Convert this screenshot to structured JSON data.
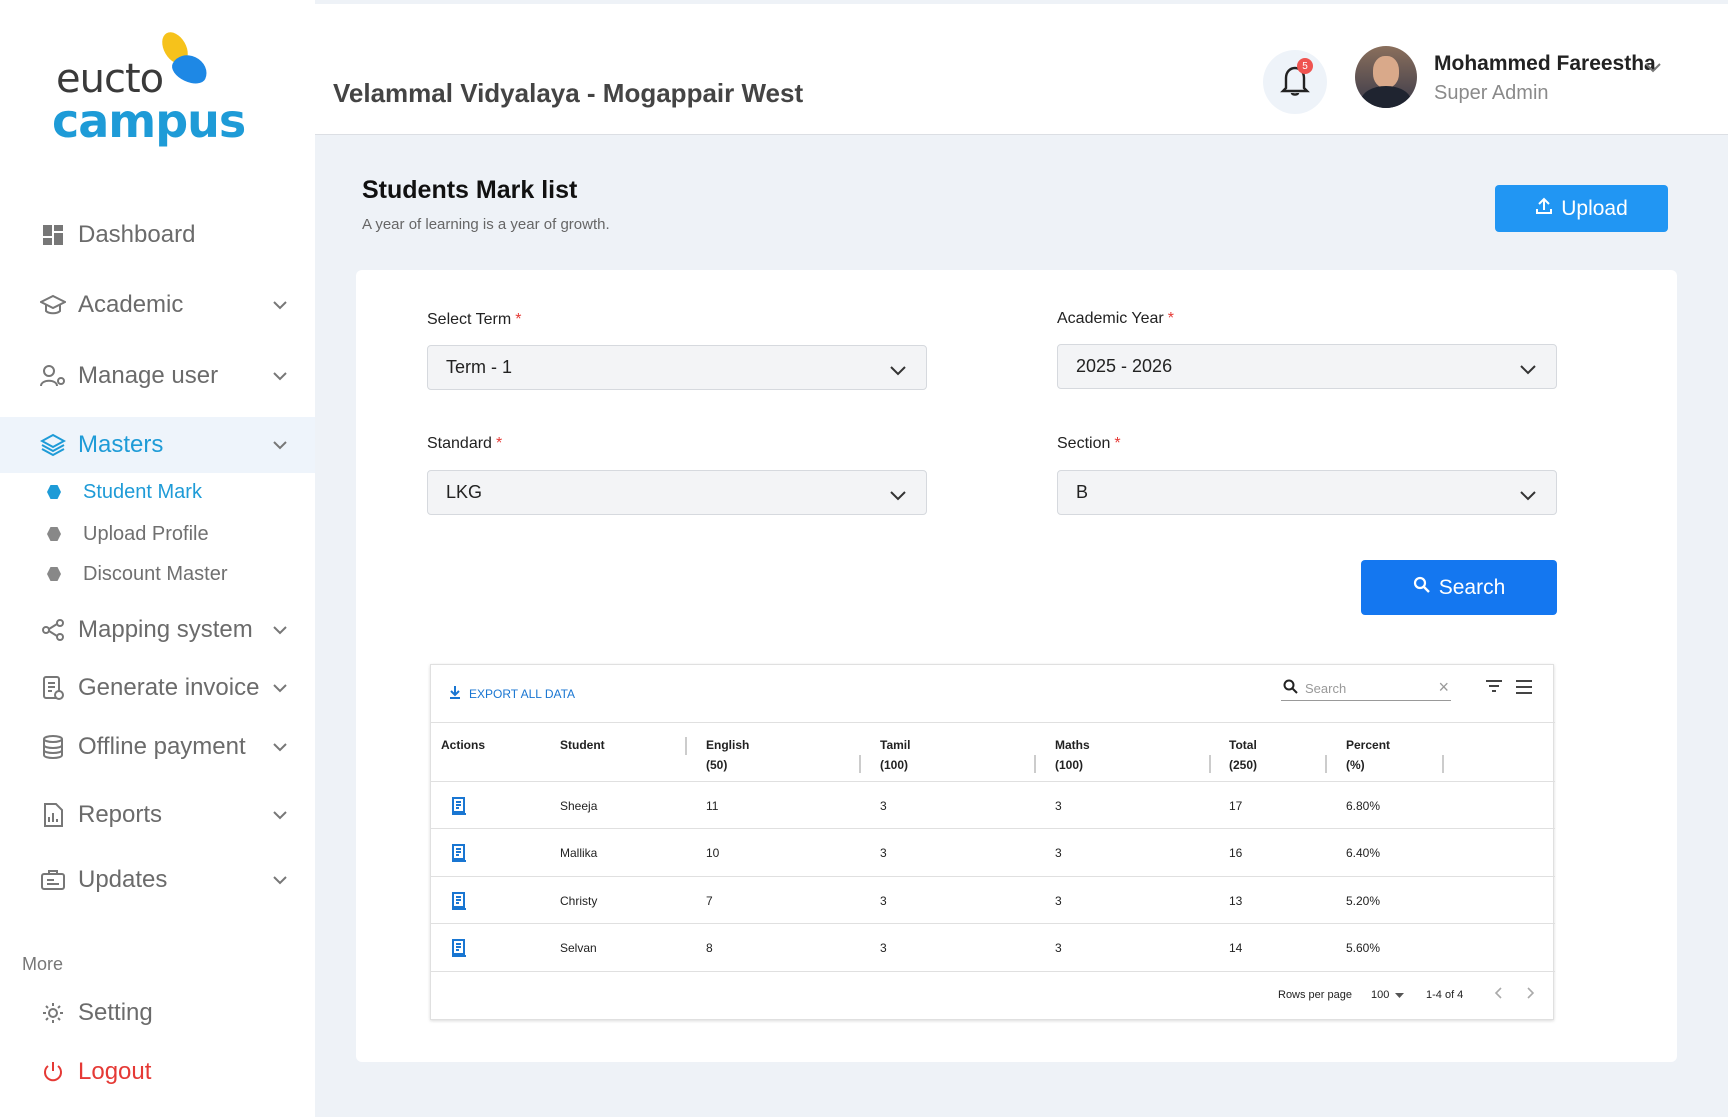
{
  "brand": {
    "line1": "eucto",
    "line2": "campus"
  },
  "sidebar": {
    "items": [
      {
        "label": "Dashboard",
        "icon": "dashboard-icon"
      },
      {
        "label": "Academic",
        "icon": "graduation-cap-icon"
      },
      {
        "label": "Manage user",
        "icon": "user-gear-icon"
      },
      {
        "label": "Masters",
        "icon": "layers-icon"
      },
      {
        "label": "Mapping system",
        "icon": "share-nodes-icon"
      },
      {
        "label": "Generate invoice",
        "icon": "invoice-icon"
      },
      {
        "label": "Offline payment",
        "icon": "database-icon"
      },
      {
        "label": "Reports",
        "icon": "report-icon"
      },
      {
        "label": "Updates",
        "icon": "updates-icon"
      }
    ],
    "sub_items": [
      "Student Mark",
      "Upload Profile",
      "Discount Master"
    ],
    "more_label": "More",
    "setting": "Setting",
    "logout": "Logout"
  },
  "header": {
    "school": "Velammal Vidyalaya - Mogappair West",
    "notification_count": "5",
    "user_name": "Mohammed Fareestha",
    "user_role": "Super Admin"
  },
  "page": {
    "title": "Students Mark list",
    "subtitle": "A year of learning is a year of growth.",
    "upload_label": "Upload"
  },
  "form": {
    "term_label": "Select Term",
    "term_value": "Term - 1",
    "year_label": "Academic Year",
    "year_value": "2025 - 2026",
    "standard_label": "Standard",
    "standard_value": "LKG",
    "section_label": "Section",
    "section_value": "B",
    "required_mark": "*",
    "search_label": "Search"
  },
  "grid": {
    "export_label": "EXPORT ALL DATA",
    "search_placeholder": "Search",
    "columns": [
      {
        "line1": "Actions",
        "line2": ""
      },
      {
        "line1": "Student",
        "line2": ""
      },
      {
        "line1": "English",
        "line2": "(50)"
      },
      {
        "line1": "Tamil",
        "line2": "(100)"
      },
      {
        "line1": "Maths",
        "line2": "(100)"
      },
      {
        "line1": "Total",
        "line2": "(250)"
      },
      {
        "line1": "Percent",
        "line2": "(%)"
      }
    ],
    "rows": [
      {
        "student": "Sheeja",
        "english": "11",
        "tamil": "3",
        "maths": "3",
        "total": "17",
        "percent": "6.80%"
      },
      {
        "student": "Mallika",
        "english": "10",
        "tamil": "3",
        "maths": "3",
        "total": "16",
        "percent": "6.40%"
      },
      {
        "student": "Christy",
        "english": "7",
        "tamil": "3",
        "maths": "3",
        "total": "13",
        "percent": "5.20%"
      },
      {
        "student": "Selvan",
        "english": "8",
        "tamil": "3",
        "maths": "3",
        "total": "14",
        "percent": "5.60%"
      }
    ],
    "rows_per_page_label": "Rows per page",
    "rows_per_page_value": "100",
    "range": "1-4 of 4"
  },
  "colors": {
    "accent": "#1e9bd7",
    "primary_button": "#2196f3",
    "search_button": "#1477f0",
    "logout": "#e53935"
  }
}
